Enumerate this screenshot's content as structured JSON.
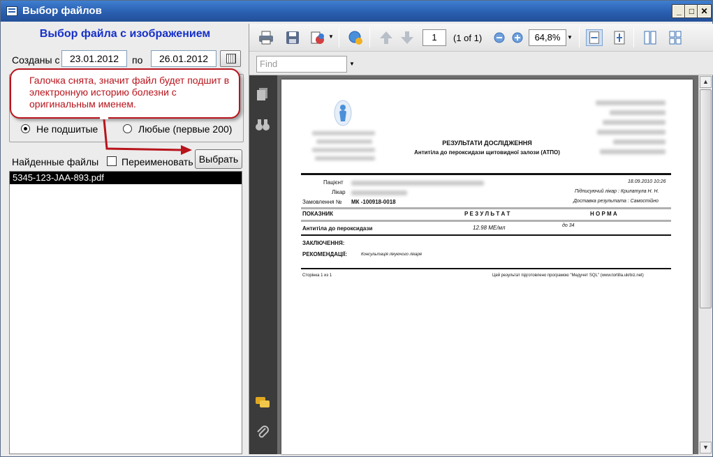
{
  "window": {
    "title": "Выбор файлов",
    "minimize": "_",
    "maximize": "□",
    "close": "✕"
  },
  "left": {
    "heading": "Выбор файла с изображением",
    "created_from_label": "Созданы с",
    "date_from": "23.01.2012",
    "to_label": "по",
    "date_to": "26.01.2012",
    "radio_not_attached": "Не подшитые",
    "radio_any": "Любые (первые 200)",
    "found_files_label": "Найденные файлы",
    "rename_label": "Переименовать",
    "select_button": "Выбрать",
    "files": [
      "5345-123-JAA-893.pdf"
    ],
    "callout": "Галочка снята, значит файл будет подшит в электронную историю болезни с оригинальным именем."
  },
  "viewer": {
    "page_number": "1",
    "page_of": "(1 of 1)",
    "zoom": "64,8%",
    "find_placeholder": "Find"
  },
  "pdf": {
    "title": "РЕЗУЛЬТАТИ ДОСЛІДЖЕННЯ",
    "subtitle": "Антитіла до пероксидази щитовидної залози (АТПО)",
    "patient_label": "Пацієнт",
    "doctor_label": "Лікар",
    "order_label": "Замовлення №",
    "order_value": "МК -100918-0018",
    "datetime": "18.09.2010 10:26",
    "signing_doctor": "Підписуючий лікар : Крилатула Н. Н.",
    "delivery": "Доставка результата : Самостійно",
    "col_indicator": "ПОКАЗНИК",
    "col_result": "Р Е З У Л Ь Т А Т",
    "col_norm": "Н О Р М А",
    "test_name": "Антитіла до пероксидази",
    "test_result": "12.98 МЕ/мл",
    "test_norm": "до 34",
    "conclusion_label": "ЗАКЛЮЧЕННЯ:",
    "recommendation_label": "РЕКОМЕНДАЦІЇ:",
    "recommendation_text": "Консультація лікуючого лікаря",
    "page_footer": "Сторінка 1 из 1",
    "footer_credit": "Цей результат підготовлено програмою \"Медучет SQL\" (www.tortilla.ukrbiz.net)"
  },
  "colors": {
    "heading": "#1530c8",
    "callout": "#b8141c",
    "titlebar": "#2a5fb0"
  }
}
